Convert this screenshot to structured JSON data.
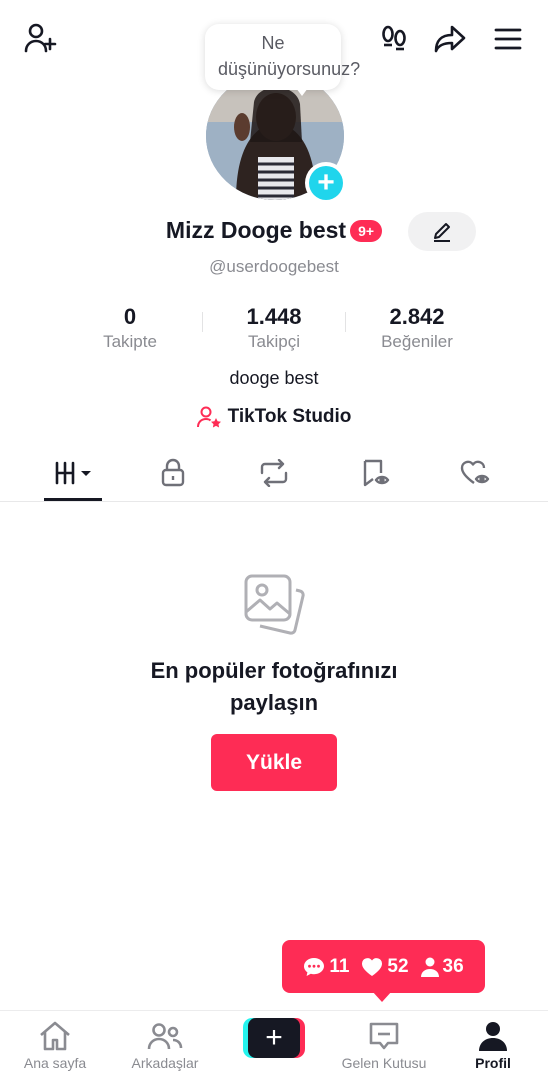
{
  "header": {
    "icons": [
      "add-friend-icon",
      "footprints-icon",
      "share-icon",
      "menu-icon"
    ]
  },
  "thought_bubble": {
    "text": "Ne düşünüyorsunuz?"
  },
  "profile": {
    "name": "Mizz Dooge best",
    "notification_badge": "9+",
    "handle": "@userdoogebest",
    "bio": "dooge best",
    "studio_link": "TikTok Studio"
  },
  "stats": [
    {
      "value": "0",
      "label": "Takipte"
    },
    {
      "value": "1.448",
      "label": "Takipçi"
    },
    {
      "value": "2.842",
      "label": "Beğeniler"
    }
  ],
  "tabs": [
    "videos-grid-icon",
    "lock-icon",
    "repost-icon",
    "favorites-icon",
    "liked-icon"
  ],
  "empty_state": {
    "title": "En popüler fotoğrafınızı paylaşın",
    "button": "Yükle"
  },
  "activity": {
    "comments": "11",
    "likes": "52",
    "followers": "36"
  },
  "bottom_nav": {
    "home": "Ana sayfa",
    "friends": "Arkadaşlar",
    "create": "+",
    "inbox": "Gelen Kutusu",
    "profile": "Profil"
  },
  "colors": {
    "accent": "#fe2c55",
    "cyan": "#25f4ee",
    "text": "#161823",
    "muted": "#8a8b91"
  }
}
